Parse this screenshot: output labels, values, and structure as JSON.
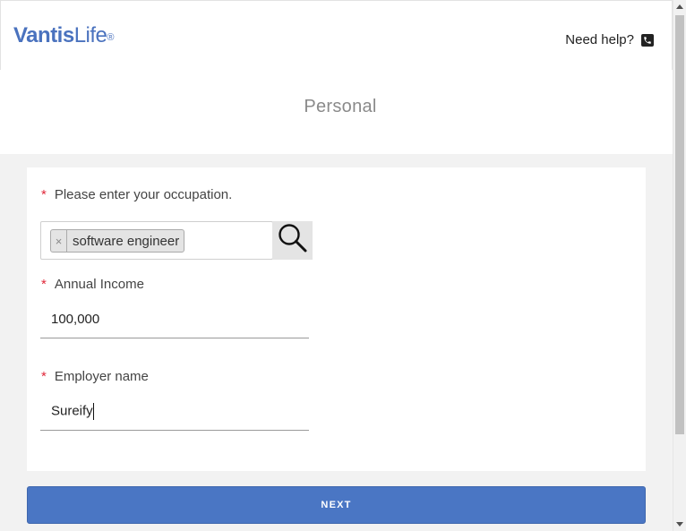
{
  "header": {
    "logo_part1": "Vantis",
    "logo_part2": "Life",
    "logo_reg": "®",
    "help_label": "Need help?",
    "help_icon": "phone-icon"
  },
  "page": {
    "title": "Personal"
  },
  "form": {
    "required_marker": "*",
    "occupation": {
      "label": "Please enter your occupation.",
      "tag_remove": "×",
      "tag_value": "software engineer",
      "search_icon": "search-icon"
    },
    "income": {
      "label": "Annual Income",
      "value": "100,000"
    },
    "employer": {
      "label": "Employer name",
      "value": "Sureify"
    }
  },
  "actions": {
    "next_label": "NEXT"
  },
  "colors": {
    "brand": "#4a72be",
    "button": "#4a76c4",
    "required": "#e0283a"
  }
}
